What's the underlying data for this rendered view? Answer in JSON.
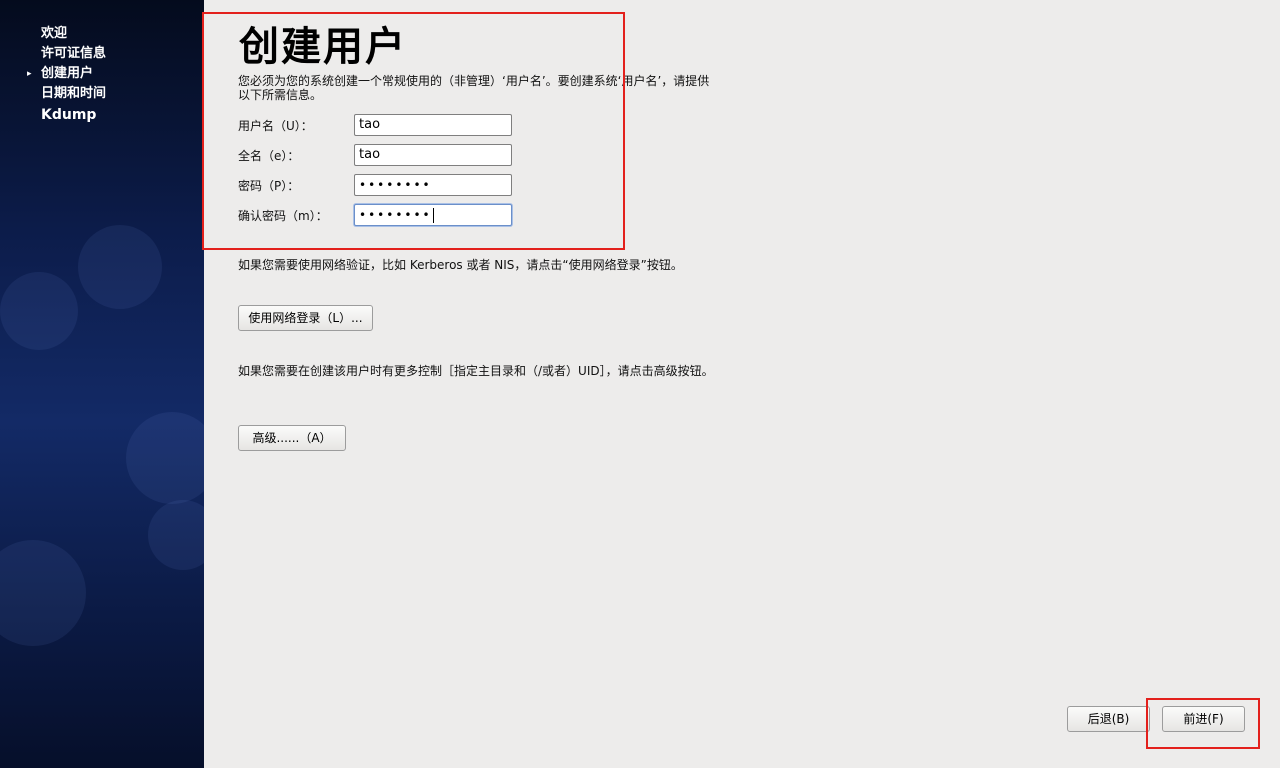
{
  "sidebar": {
    "items": [
      {
        "label": "欢迎",
        "current": false
      },
      {
        "label": "许可证信息",
        "current": false
      },
      {
        "label": "创建用户",
        "current": true
      },
      {
        "label": "日期和时间",
        "current": false
      },
      {
        "label": "Kdump",
        "current": false
      }
    ],
    "current_indicator": "▸"
  },
  "page": {
    "title": "创建用户",
    "intro": "您必须为您的系统创建一个常规使用的（非管理）‘用户名’。要创建系统‘用户名’，请提供以下所需信息。"
  },
  "form": {
    "username": {
      "label": "用户名（U）：",
      "value": "tao"
    },
    "fullname": {
      "label": "全名（e）：",
      "value": "tao"
    },
    "password": {
      "label": "密码（P）：",
      "masked": "••••••••"
    },
    "confirm": {
      "label": "确认密码（m）：",
      "masked": "••••••••"
    }
  },
  "network": {
    "text": "如果您需要使用网络验证，比如 Kerberos 或者 NIS，请点击“使用网络登录”按钮。",
    "button_label": "使用网络登录（L）..."
  },
  "advanced": {
    "text": "如果您需要在创建该用户时有更多控制［指定主目录和（/或者）UID］，请点击高级按钮。",
    "button_label": "高级......（A）"
  },
  "footer": {
    "back_label": "后退(B)",
    "forward_label": "前进(F)"
  },
  "colors": {
    "annotation": "#e3201c",
    "sidebar_bg": "#0c1c4a",
    "page_bg": "#edeceb"
  }
}
